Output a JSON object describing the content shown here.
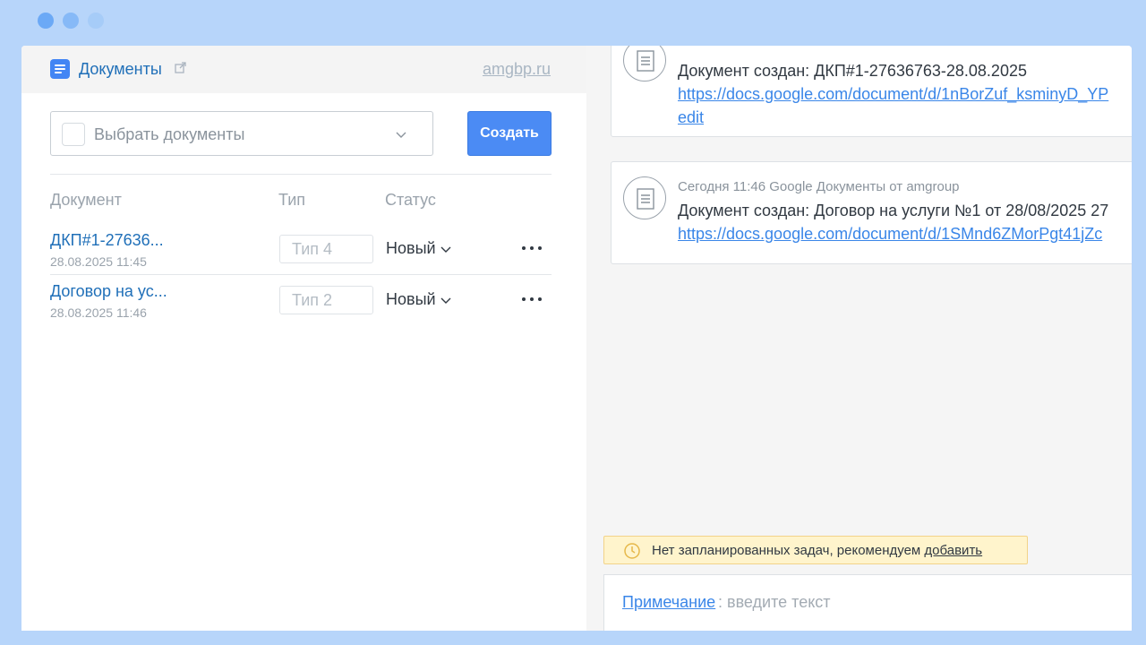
{
  "window_dots": [
    "close",
    "minimize",
    "maximize"
  ],
  "documents_panel": {
    "title": "Документы",
    "domain": "amgbp.ru",
    "select_placeholder": "Выбрать документы",
    "create_button": "Создать",
    "columns": [
      "Документ",
      "Тип",
      "Статус"
    ],
    "rows": [
      {
        "name": "ДКП#1-27636...",
        "date": "28.08.2025 11:45",
        "type": "Тип 4",
        "status": "Новый"
      },
      {
        "name": "Договор на ус...",
        "date": "28.08.2025 11:46",
        "type": "Тип 2",
        "status": "Новый"
      }
    ]
  },
  "feed": {
    "items": [
      {
        "meta": "",
        "title": "Документ создан: ДКП#1-27636763-28.08.2025",
        "link_line1": "https://docs.google.com/document/d/1nBorZuf_ksminyD_YP",
        "link_line2": "edit"
      },
      {
        "meta": "Сегодня 11:46 Google Документы от amgroup",
        "title": "Документ создан: Договор на услуги №1 от 28/08/2025 27",
        "link_line1": "https://docs.google.com/document/d/1SMnd6ZMorPgt41jZc"
      }
    ]
  },
  "tasks_notice": {
    "text": "Нет запланированных задач, рекомендуем ",
    "link": "добавить"
  },
  "note_input": {
    "label": "Примечание",
    "placeholder": ": введите текст"
  },
  "colors": {
    "accent": "#4b8bf4",
    "link": "#1f6fb8",
    "background": "#b7d5fa",
    "notice_bg": "#fff4cc"
  },
  "icons": [
    "google-docs-icon",
    "external-link-icon",
    "chevron-down-icon",
    "more-icon",
    "document-icon",
    "clock-icon"
  ]
}
